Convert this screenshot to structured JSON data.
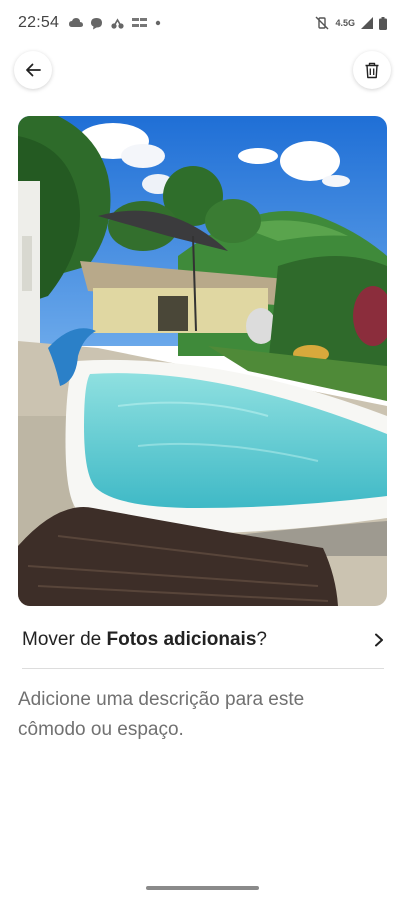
{
  "status_bar": {
    "time": "22:54",
    "network": "4.5G",
    "notification_icons": [
      "cloud-icon",
      "chat-bubble-icon",
      "fan-icon",
      "app-text-icon",
      "dot-icon"
    ],
    "system_icons": [
      "mute-vibrate-icon",
      "signal-icon",
      "battery-icon"
    ]
  },
  "toolbar": {
    "back_icon": "arrow-left-icon",
    "delete_icon": "trash-icon"
  },
  "photo": {
    "subject": "pool-photo"
  },
  "move_prompt": {
    "prefix": "Mover de ",
    "target": "Fotos adicionais",
    "suffix": "?",
    "chevron_icon": "chevron-right-icon"
  },
  "description": {
    "placeholder": "Adicione uma descrição para este cômodo ou espaço."
  },
  "colors": {
    "text": "#222222",
    "muted": "#717171",
    "divider": "#dddddd"
  }
}
